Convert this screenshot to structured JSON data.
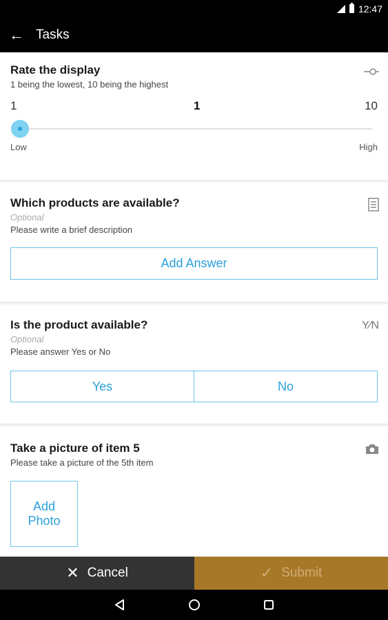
{
  "status_bar": {
    "time": "12:47"
  },
  "app_bar": {
    "title": "Tasks"
  },
  "questions": {
    "rate": {
      "title": "Rate the display",
      "description": "1 being the lowest, 10 being the highest",
      "min": "1",
      "current": "1",
      "max": "10",
      "low_label": "Low",
      "high_label": "High",
      "value_fraction": 0
    },
    "products": {
      "title": "Which products are available?",
      "optional": "Optional",
      "description": "Please write a brief description",
      "button": "Add Answer"
    },
    "availability": {
      "title": "Is the product available?",
      "optional": "Optional",
      "description": "Please answer Yes or No",
      "yes": "Yes",
      "no": "No"
    },
    "picture": {
      "title": "Take a picture of item 5",
      "description": "Please take a picture of the 5th item",
      "button_line1": "Add",
      "button_line2": "Photo"
    }
  },
  "actions": {
    "cancel": "Cancel",
    "submit": "Submit"
  },
  "colors": {
    "accent": "#2aa0da",
    "submit_bg": "#a87829",
    "cancel_bg": "#333333"
  },
  "icons": [
    "back-arrow-icon",
    "slider-icon",
    "text-list-icon",
    "yes-no-icon",
    "camera-icon",
    "close-icon",
    "check-icon",
    "nav-back-icon",
    "nav-home-icon",
    "nav-recents-icon"
  ]
}
